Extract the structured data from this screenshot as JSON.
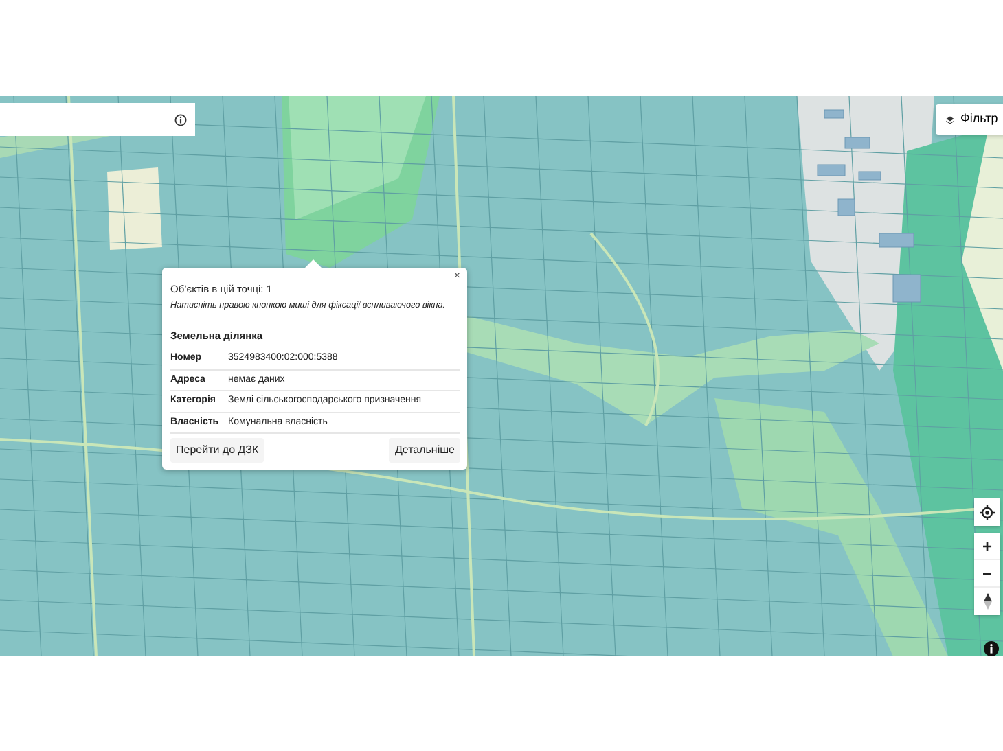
{
  "filter_button": {
    "label": "Фільтр"
  },
  "popup": {
    "count_text": "Об’єктів в цій точці: 1",
    "hint": "Натисніть правою кнопкою миші для фіксації вспливаючого вікна.",
    "close": "×",
    "section_title": "Земельна ділянка",
    "rows": [
      {
        "label": "Номер",
        "value": "3524983400:02:000:5388"
      },
      {
        "label": "Адреса",
        "value": "немає даних"
      },
      {
        "label": "Категорія",
        "value": "Землі сільськогосподарського призначення"
      },
      {
        "label": "Власність",
        "value": "Комунальна власність"
      }
    ],
    "buttons": [
      "Перейти до ДЗК",
      "Детальніше"
    ]
  },
  "zoom_controls": [
    "+",
    "−"
  ]
}
